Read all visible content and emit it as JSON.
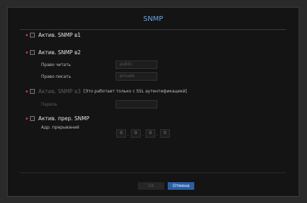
{
  "dialog": {
    "title": "SNMP"
  },
  "snmp_v1": {
    "label": "Актив. SNMP в1",
    "checked": false
  },
  "snmp_v2": {
    "label": "Актив. SNMP в2",
    "checked": false,
    "read_label": "Право читать",
    "read_value": "public",
    "write_label": "Право писать",
    "write_value": "private"
  },
  "snmp_v3": {
    "label": "Актив. SNMP в3",
    "note": "[Это работает только с SSL аутентификацией]",
    "checked": false,
    "password_label": "Пароль",
    "password_value": ""
  },
  "trap": {
    "label": "Актив. прер. SNMP",
    "checked": false,
    "address_label": "Адр. прерываний",
    "ip": [
      "0",
      "0",
      "0",
      "0"
    ]
  },
  "buttons": {
    "ok": "OK",
    "cancel": "Отмена"
  },
  "colors": {
    "accent": "#6aa6e8",
    "cancel_bg": "#2a5ea6",
    "required_dot": "#cc3333"
  }
}
